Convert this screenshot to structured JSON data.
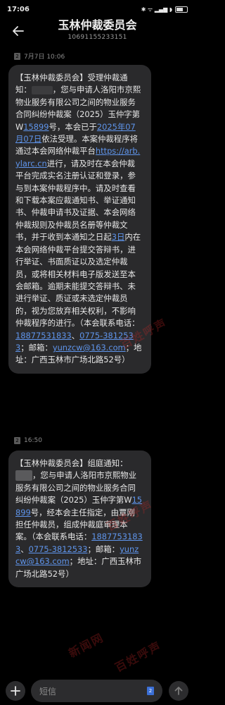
{
  "status_bar": {
    "time": "17:06",
    "right_text": "✱ ᯤ ▂▄▆ ◗",
    "battery_icon": "battery-icon"
  },
  "header": {
    "title": "玉林仲裁委员会",
    "number": "10691155233151",
    "back_icon": "back-arrow-icon"
  },
  "messages": [
    {
      "sim": "2",
      "time": "7月7日 10:06",
      "parts": {
        "p1": "【玉林仲裁委员会】受理仲裁通知：",
        "p2": "，您与申请人洛阳市京熙物业服务有限公司之间的物业服务合同纠纷仲裁案（2025）玉仲字第W",
        "case_no": "15899",
        "p3": "号，本会已于",
        "date": "2025年07月07日",
        "p4": "依法受理。本案仲裁程序将通过本会网络仲裁平台",
        "url": "https://arb.ylarc.cn",
        "p5": "进行，请及时在本会仲裁平台完成实名注册认证和登录，参与到本案仲裁程序中。请及时查看和下载本案应裁通知书、举证通知书、仲裁申请书及证据、本会网络仲裁规则及仲裁员名册等仲裁文书，并于收到本通知之日起",
        "days": "3日",
        "p6": "内在本会网络仲裁平台提交答辩书，进行举证、书面质证以及选定仲裁员，或将相关材料电子版发送至本会邮箱。逾期未能提交答辩书、未进行举证、质证或未选定仲裁员的，视为您放弃相关权利，不影响仲裁程序的进行。（本会联系电话：",
        "phone1": "18877531833",
        "sep": "、",
        "phone2": "0775-3812533",
        "p7": "；邮箱：",
        "email": "yunzcw@163.com",
        "p8": "；地址：广西玉林市广场北路52号）"
      }
    },
    {
      "sim": "2",
      "time": "16:50",
      "parts": {
        "p1": "【玉林仲裁委员会】组庭通知：",
        "p2": "，您与申请人洛阳市京熙物业服务有限公司之间的物业服务合同纠纷仲裁案（2025）玉仲字第W",
        "case_no": "15899",
        "p3": "号，经本会主任指定，由覃刚担任仲裁员，组成仲裁庭审理本案。（本会联系电话：",
        "phone1": "18877531833",
        "sep": "、",
        "phone2": "0775-3812533",
        "p4": "；邮箱：",
        "email": "yunzcw@163.com",
        "p5": "；地址：广西玉林市广场北路52号）"
      }
    }
  ],
  "watermark": "百姓呼声",
  "watermark2": "新闻网",
  "bottom": {
    "placeholder": "短信",
    "sim": "2",
    "add_icon": "plus-icon",
    "send_icon": "send-icon"
  },
  "colors": {
    "background": "#000000",
    "bubble": "#2a2a2c",
    "link": "#5f95ec",
    "watermark": "#c82828"
  }
}
